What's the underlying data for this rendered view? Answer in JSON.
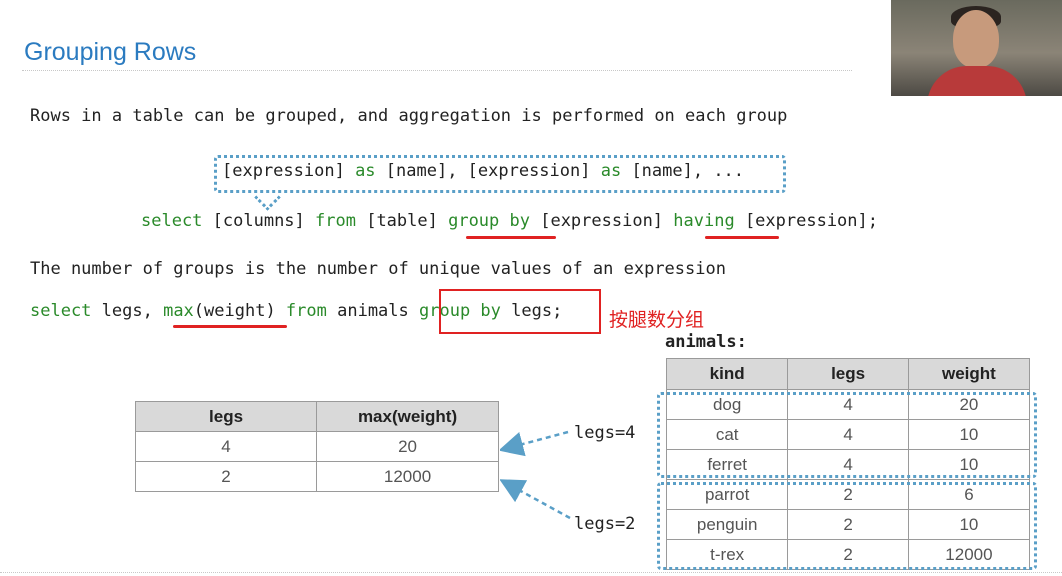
{
  "title": "Grouping Rows",
  "intro": "Rows in a table can be grouped, and aggregation is performed on each group",
  "syntax_top": {
    "p1": "[expression] ",
    "as1": "as",
    "p2": " [name], [expression] ",
    "as2": "as",
    "p3": " [name], ..."
  },
  "syntax_main": {
    "select": "select",
    "p1": " [columns] ",
    "from": "from",
    "p2": " [table] ",
    "group_by": "group by",
    "p3": " [expression] ",
    "having": "having",
    "p4": " [expression];"
  },
  "groups_sentence": "The number of groups is the number of unique values of an expression",
  "example": {
    "select": "select",
    "p1": " legs, ",
    "max": "max",
    "p2": "(weight) ",
    "from": "from",
    "p3": " animals ",
    "group_by": "group by",
    "p4": " legs;"
  },
  "annotation": "按腿数分组",
  "animals_label": "animals:",
  "animals_table": {
    "headers": [
      "kind",
      "legs",
      "weight"
    ],
    "rows": [
      [
        "dog",
        "4",
        "20"
      ],
      [
        "cat",
        "4",
        "10"
      ],
      [
        "ferret",
        "4",
        "10"
      ],
      [
        "parrot",
        "2",
        "6"
      ],
      [
        "penguin",
        "2",
        "10"
      ],
      [
        "t-rex",
        "2",
        "12000"
      ]
    ]
  },
  "result_table": {
    "headers": [
      "legs",
      "max(weight)"
    ],
    "rows": [
      [
        "4",
        "20"
      ],
      [
        "2",
        "12000"
      ]
    ]
  },
  "group_labels": [
    "legs=4",
    "legs=2"
  ],
  "colors": {
    "title": "#2b7bc0",
    "keyword": "#2a8a2a",
    "highlight": "#e02222",
    "dotted_box": "#5a9fc7"
  }
}
